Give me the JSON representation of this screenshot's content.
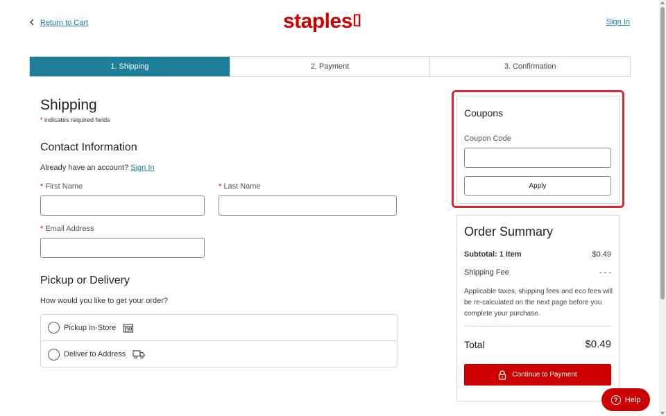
{
  "header": {
    "return_label": "Return to Cart",
    "logo_text": "staples",
    "logo_bracket": "[]",
    "sign_in": "Sign In"
  },
  "steps": [
    {
      "label": "1. Shipping",
      "active": true
    },
    {
      "label": "2. Payment",
      "active": false
    },
    {
      "label": "3. Confirmation",
      "active": false
    }
  ],
  "shipping": {
    "title": "Shipping",
    "required_star": "*",
    "required_note": " indicates required fields",
    "contact_title": "Contact Information",
    "account_prompt": "Already have an account?",
    "account_link": "Sign In",
    "first_name_label": "First Name",
    "last_name_label": "Last Name",
    "email_label": "Email Address",
    "first_name_value": "",
    "last_name_value": "",
    "email_value": ""
  },
  "delivery": {
    "title": "Pickup or Delivery",
    "question": "How would you like to get your order?",
    "options": [
      {
        "label": "Pickup In-Store",
        "icon": "store-icon"
      },
      {
        "label": "Deliver to Address",
        "icon": "truck-icon"
      }
    ]
  },
  "coupons": {
    "title": "Coupons",
    "code_label": "Coupon Code",
    "code_value": "",
    "apply_label": "Apply"
  },
  "summary": {
    "title": "Order Summary",
    "subtotal_label": "Subtotal: 1 Item",
    "subtotal_value": "$0.49",
    "shipping_label": "Shipping Fee",
    "shipping_value": "- - -",
    "note": "Applicable taxes, shipping fees and eco fees will be re-calculated on the next page before you complete your purchase.",
    "total_label": "Total",
    "total_value": "$0.49",
    "continue_label": "Continue to Payment"
  },
  "help": {
    "label": "Help",
    "icon_glyph": "?"
  },
  "colors": {
    "brand_red": "#cc0000",
    "step_active": "#1b8097",
    "link": "#1a7fa0",
    "highlight": "#e0262f"
  }
}
